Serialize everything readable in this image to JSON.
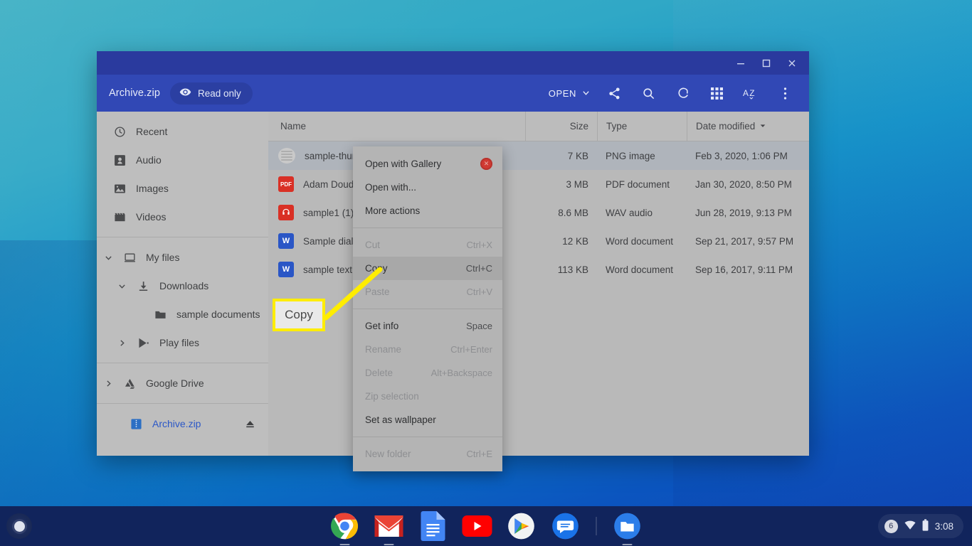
{
  "window": {
    "title": "Archive.zip",
    "readonly_label": "Read only",
    "controls": {
      "minimize": "minimize",
      "maximize": "maximize",
      "close": "close"
    },
    "toolbar": {
      "open_label": "OPEN",
      "icons": [
        "share-icon",
        "search-icon",
        "refresh-icon",
        "grid-view-icon",
        "sort-az-icon",
        "more-options-icon"
      ]
    }
  },
  "sidebar": {
    "items": [
      {
        "label": "Recent",
        "icon": "clock-icon",
        "indent": 0,
        "caret": ""
      },
      {
        "label": "Audio",
        "icon": "audio-icon",
        "indent": 0,
        "caret": ""
      },
      {
        "label": "Images",
        "icon": "image-icon",
        "indent": 0,
        "caret": ""
      },
      {
        "label": "Videos",
        "icon": "video-icon",
        "indent": 0,
        "caret": ""
      },
      {
        "label": "My files",
        "icon": "laptop-icon",
        "indent": 0,
        "caret": "down"
      },
      {
        "label": "Downloads",
        "icon": "download-icon",
        "indent": 1,
        "caret": "down"
      },
      {
        "label": "sample documents",
        "icon": "folder-icon",
        "indent": 2,
        "caret": ""
      },
      {
        "label": "Play files",
        "icon": "play-store-icon",
        "indent": 1,
        "caret": "right"
      },
      {
        "label": "Google Drive",
        "icon": "google-drive-icon",
        "indent": 0,
        "caret": "right"
      },
      {
        "label": "Archive.zip",
        "icon": "zip-icon",
        "indent": 0,
        "caret": "",
        "accent": true,
        "eject": true
      }
    ]
  },
  "filelist": {
    "columns": [
      "Name",
      "Size",
      "Type",
      "Date modified"
    ],
    "sorted_column": "Date modified",
    "rows": [
      {
        "name": "sample-thumbnail.png",
        "size": "7 KB",
        "type": "PNG image",
        "date": "Feb 3, 2020, 1:06 PM",
        "icon": "image-thumbnail",
        "selected": true
      },
      {
        "name": "Adam Doud Writing Sample.pdf",
        "size": "3 MB",
        "type": "PDF document",
        "date": "Jan 30, 2020, 8:50 PM",
        "icon": "pdf",
        "selected": false
      },
      {
        "name": "sample1 (1).wav",
        "size": "8.6 MB",
        "type": "WAV audio",
        "date": "Jun 28, 2019, 9:13 PM",
        "icon": "wav",
        "selected": false
      },
      {
        "name": "Sample dialogue.docx",
        "size": "12 KB",
        "type": "Word document",
        "date": "Sep 21, 2017, 9:57 PM",
        "icon": "doc",
        "selected": false
      },
      {
        "name": "sample text.docx",
        "size": "113 KB",
        "type": "Word document",
        "date": "Sep 16, 2017, 9:11 PM",
        "icon": "doc",
        "selected": false
      }
    ]
  },
  "context_menu": {
    "items": [
      {
        "label": "Open with Gallery",
        "accel": "",
        "disabled": false,
        "highlighted": false,
        "trailing_icon": "gallery-app-icon"
      },
      {
        "label": "Open with...",
        "accel": "",
        "disabled": false,
        "highlighted": false
      },
      {
        "label": "More actions",
        "accel": "",
        "disabled": false,
        "highlighted": false
      },
      {
        "separator": true
      },
      {
        "label": "Cut",
        "accel": "Ctrl+X",
        "disabled": true,
        "highlighted": false
      },
      {
        "label": "Copy",
        "accel": "Ctrl+C",
        "disabled": false,
        "highlighted": true
      },
      {
        "label": "Paste",
        "accel": "Ctrl+V",
        "disabled": true,
        "highlighted": false
      },
      {
        "separator": true
      },
      {
        "label": "Get info",
        "accel": "Space",
        "disabled": false,
        "highlighted": false
      },
      {
        "label": "Rename",
        "accel": "Ctrl+Enter",
        "disabled": true,
        "highlighted": false
      },
      {
        "label": "Delete",
        "accel": "Alt+Backspace",
        "disabled": true,
        "highlighted": false
      },
      {
        "label": "Zip selection",
        "accel": "",
        "disabled": true,
        "highlighted": false
      },
      {
        "label": "Set as wallpaper",
        "accel": "",
        "disabled": false,
        "highlighted": false
      },
      {
        "separator": true
      },
      {
        "label": "New folder",
        "accel": "Ctrl+E",
        "disabled": true,
        "highlighted": false
      }
    ]
  },
  "callout": {
    "label": "Copy",
    "border_color": "#ffed00",
    "fill_color": "#e9e9e9"
  },
  "shelf": {
    "launcher": "launcher-button",
    "apps": [
      {
        "name": "chrome-app-icon",
        "running": true
      },
      {
        "name": "gmail-app-icon",
        "running": true
      },
      {
        "name": "google-docs-app-icon",
        "running": false
      },
      {
        "name": "youtube-app-icon",
        "running": false
      },
      {
        "name": "play-store-app-icon",
        "running": false
      },
      {
        "name": "messages-app-icon",
        "running": false
      },
      {
        "name": "files-app-icon",
        "running": true
      }
    ],
    "tray": {
      "notification_count": "6",
      "wifi": "wifi-icon",
      "battery": "battery-icon",
      "time": "3:08"
    }
  },
  "colors": {
    "titlebar": "#2a3a9e",
    "toolbar": "#3148b5",
    "accent": "#2b57c7",
    "highlight_yellow": "#ffed00",
    "shelf": "#11245c"
  }
}
